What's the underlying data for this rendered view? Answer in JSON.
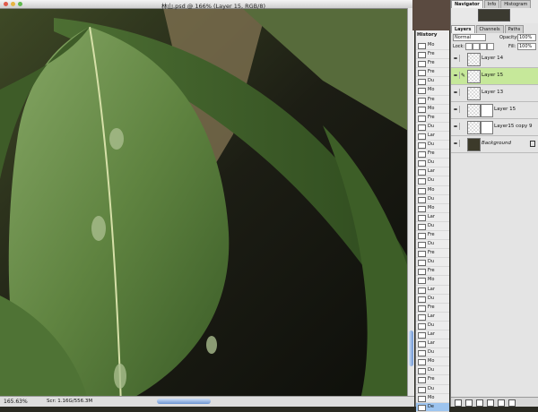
{
  "document": {
    "title": "林山.psd @ 166% (Layer 15, RGB/8)",
    "zoom": "165.63%",
    "doc_size": "Scr: 1.16G/556.3M"
  },
  "history": {
    "tab_label": "History",
    "items": [
      "Mo",
      "Fre",
      "Fre",
      "Fre",
      "Du",
      "Mo",
      "Fre",
      "Mo",
      "Fre",
      "Du",
      "Lar",
      "Du",
      "Fre",
      "Du",
      "Lar",
      "Du",
      "Mo",
      "Du",
      "Mo",
      "Lar",
      "Du",
      "Fre",
      "Du",
      "Fre",
      "Du",
      "Fre",
      "Mo",
      "Lar",
      "Du",
      "Fre",
      "Lar",
      "Du",
      "Lar",
      "Lar",
      "Du",
      "Mo",
      "Du",
      "Fre",
      "Du",
      "Mo",
      "De"
    ],
    "active_index": 40
  },
  "navigator": {
    "tabs": [
      "Navigator",
      "Info",
      "Histogram"
    ],
    "active_tab": "Navigator"
  },
  "layers_panel": {
    "tabs": [
      "Layers",
      "Channels",
      "Paths"
    ],
    "active_tab": "Layers",
    "blend_mode": "Normal",
    "opacity_label": "Opacity:",
    "opacity_value": "100%",
    "lock_label": "Lock:",
    "fill_label": "Fill:",
    "fill_value": "100%",
    "layers": [
      {
        "name": "Layer 14",
        "active": false,
        "has_mask": false,
        "is_background": false
      },
      {
        "name": "Layer 15",
        "active": true,
        "has_mask": false,
        "is_background": false
      },
      {
        "name": "Layer 13",
        "active": false,
        "has_mask": false,
        "is_background": false
      },
      {
        "name": "Layer 15",
        "active": false,
        "has_mask": true,
        "is_background": false
      },
      {
        "name": "Layer15 copy 9",
        "active": false,
        "has_mask": true,
        "is_background": false
      },
      {
        "name": "Background",
        "active": false,
        "has_mask": false,
        "is_background": true
      }
    ]
  },
  "colors": {
    "accent_active_layer": "#c6e89a",
    "history_selected": "#9dc4ef"
  }
}
